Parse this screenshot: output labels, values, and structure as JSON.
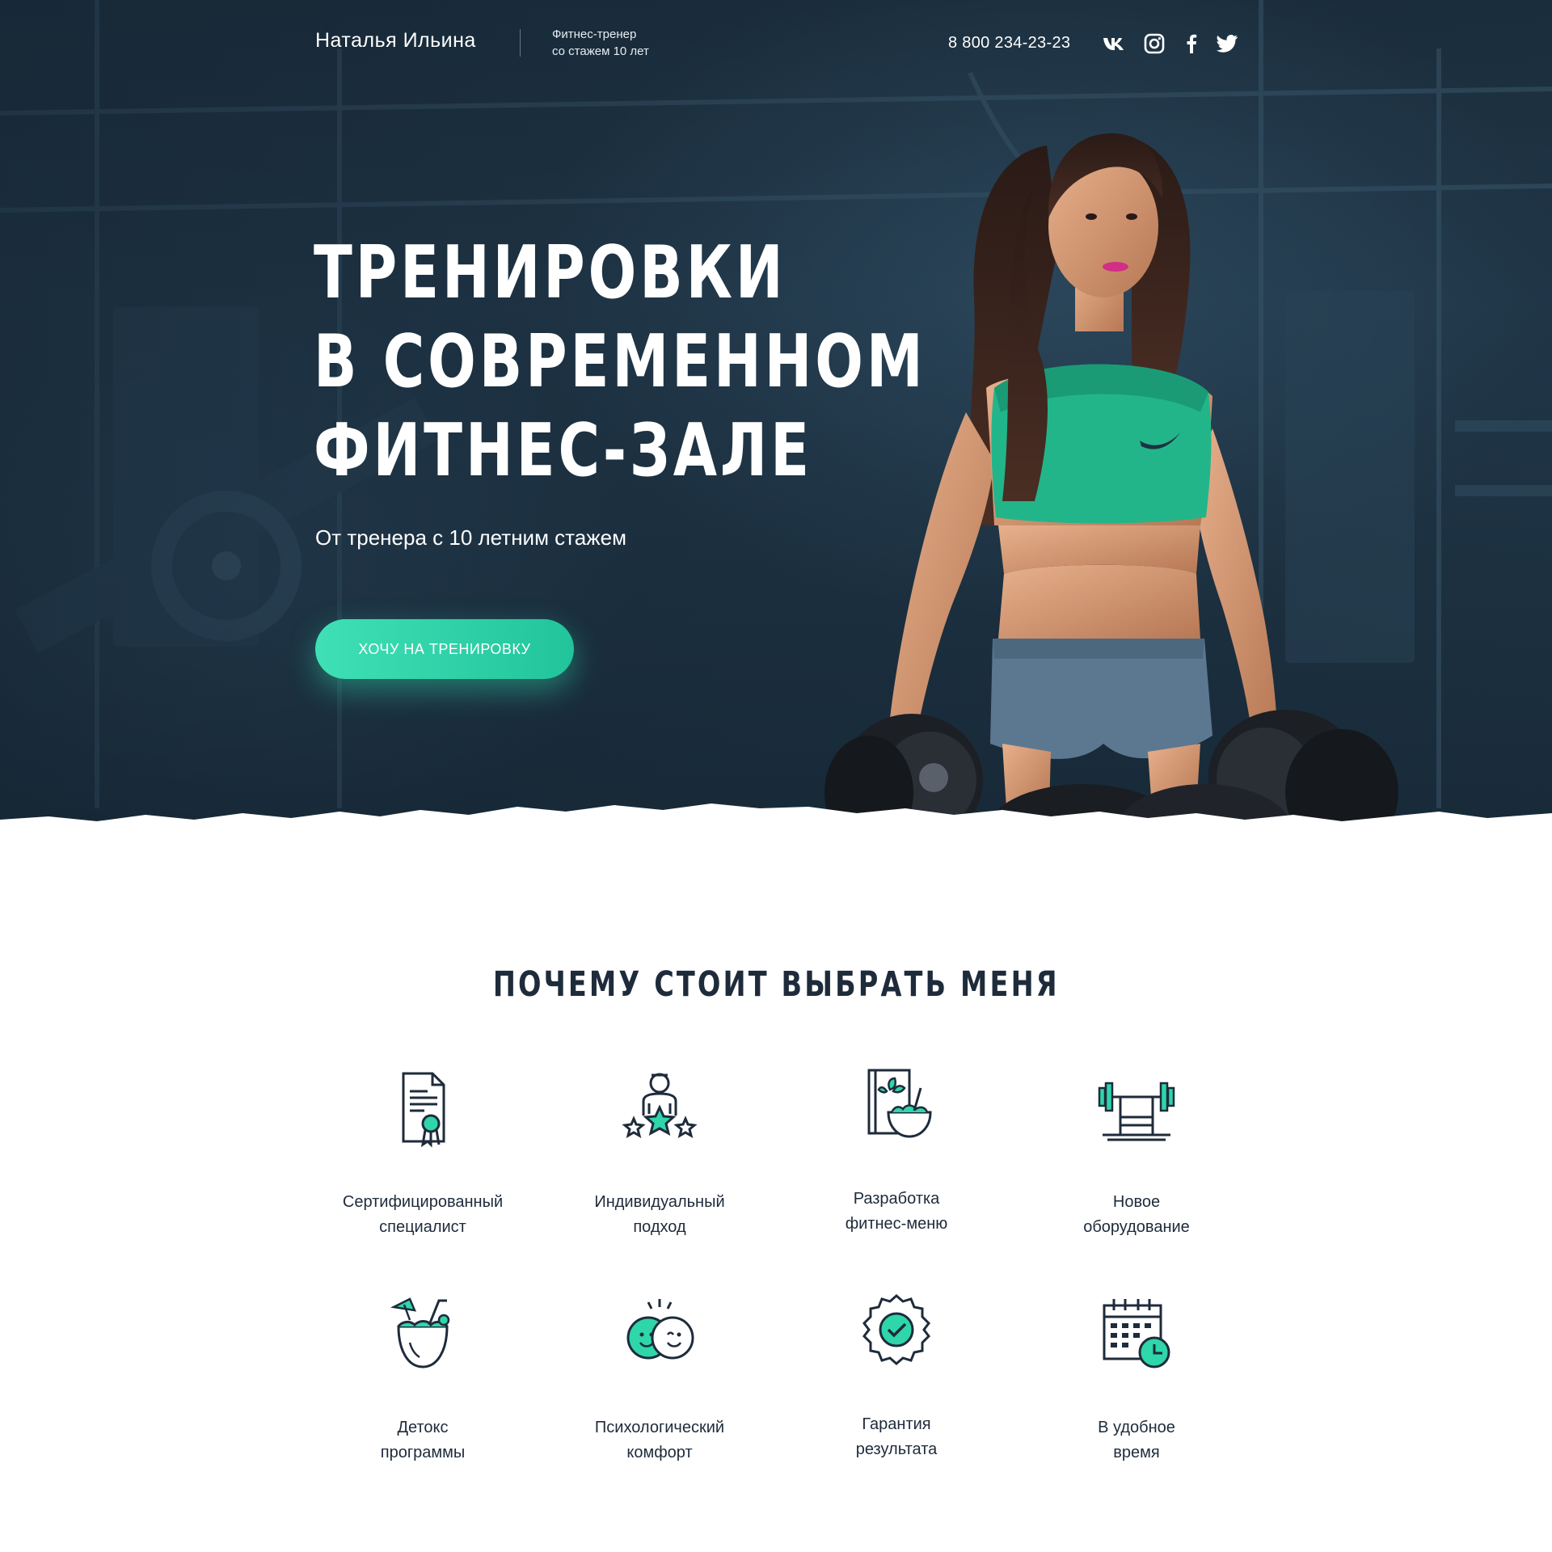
{
  "header": {
    "name": "Наталья Ильина",
    "tagline_line1": "Фитнес-тренер",
    "tagline_line2": "со стажем 10 лет",
    "phone": "8 800 234-23-23",
    "social_icons": [
      "vk-icon",
      "instagram-icon",
      "facebook-icon",
      "twitter-icon"
    ]
  },
  "hero": {
    "title_lines": [
      "ТРЕНИРОВКИ",
      "В СОВРЕМЕННОМ",
      "ФИТНЕС-ЗАЛЕ"
    ],
    "subtitle": "От тренера с 10 летним стажем",
    "cta_label": "ХОЧУ НА ТРЕНИРОВКУ"
  },
  "features": {
    "title": "ПОЧЕМУ СТОИТ ВЫБРАТЬ МЕНЯ",
    "items": [
      {
        "icon": "certificate-icon",
        "line1": "Сертифицированный",
        "line2": "специалист"
      },
      {
        "icon": "personal-approach-icon",
        "line1": "Индивидуальный",
        "line2": "подход"
      },
      {
        "icon": "fitness-menu-icon",
        "line1": "Разработка",
        "line2": "фитнес-меню"
      },
      {
        "icon": "barbell-equipment-icon",
        "line1": "Новое",
        "line2": "оборудование"
      },
      {
        "icon": "coconut-detox-icon",
        "line1": "Детокс",
        "line2": "программы"
      },
      {
        "icon": "smiles-comfort-icon",
        "line1": "Психологический",
        "line2": "комфорт"
      },
      {
        "icon": "guarantee-badge-icon",
        "line1": "Гарантия",
        "line2": "результата"
      },
      {
        "icon": "calendar-clock-icon",
        "line1": "В удобное",
        "line2": "время"
      }
    ]
  },
  "colors": {
    "accent": "#2fd6aa",
    "dark_text": "#1e2b3b",
    "hero_bg": "#1f3445"
  }
}
